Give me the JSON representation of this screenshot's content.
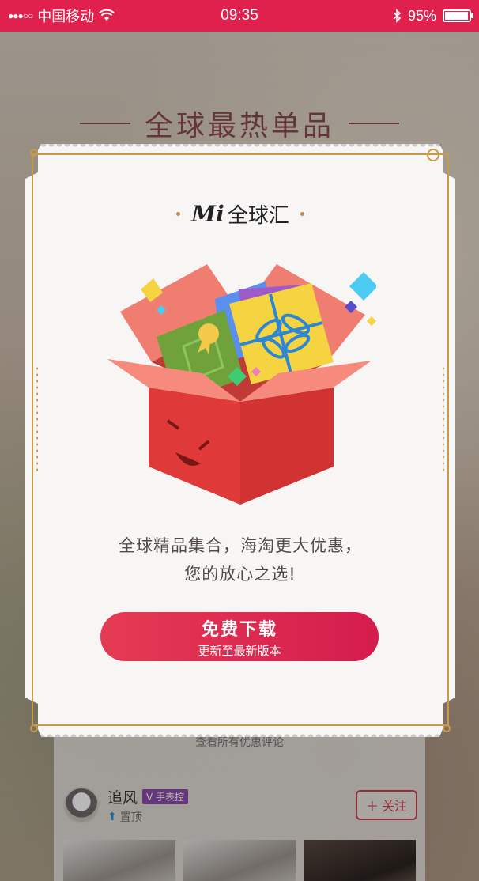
{
  "status_bar": {
    "carrier": "中国移动",
    "time": "09:35",
    "battery_text": "95%",
    "battery_level": 0.95,
    "signal_icon": "●●●○○"
  },
  "background": {
    "heading": "全球最热单品",
    "more_text": "查看所有优惠评论",
    "user_name": "追风",
    "user_badge": "V 手表控",
    "pin_label": "置顶",
    "follow_label": "关注"
  },
  "modal": {
    "brand_mi": "Mi",
    "brand_cn": "全球汇",
    "tagline_line1": "全球精品集合，海淘更大优惠，",
    "tagline_line2": "您的放心之选!",
    "cta_main": "免费下载",
    "cta_sub": "更新至最新版本"
  },
  "colors": {
    "accent": "#e0204d",
    "gold": "#c89a48",
    "button": "#d41c4d"
  }
}
